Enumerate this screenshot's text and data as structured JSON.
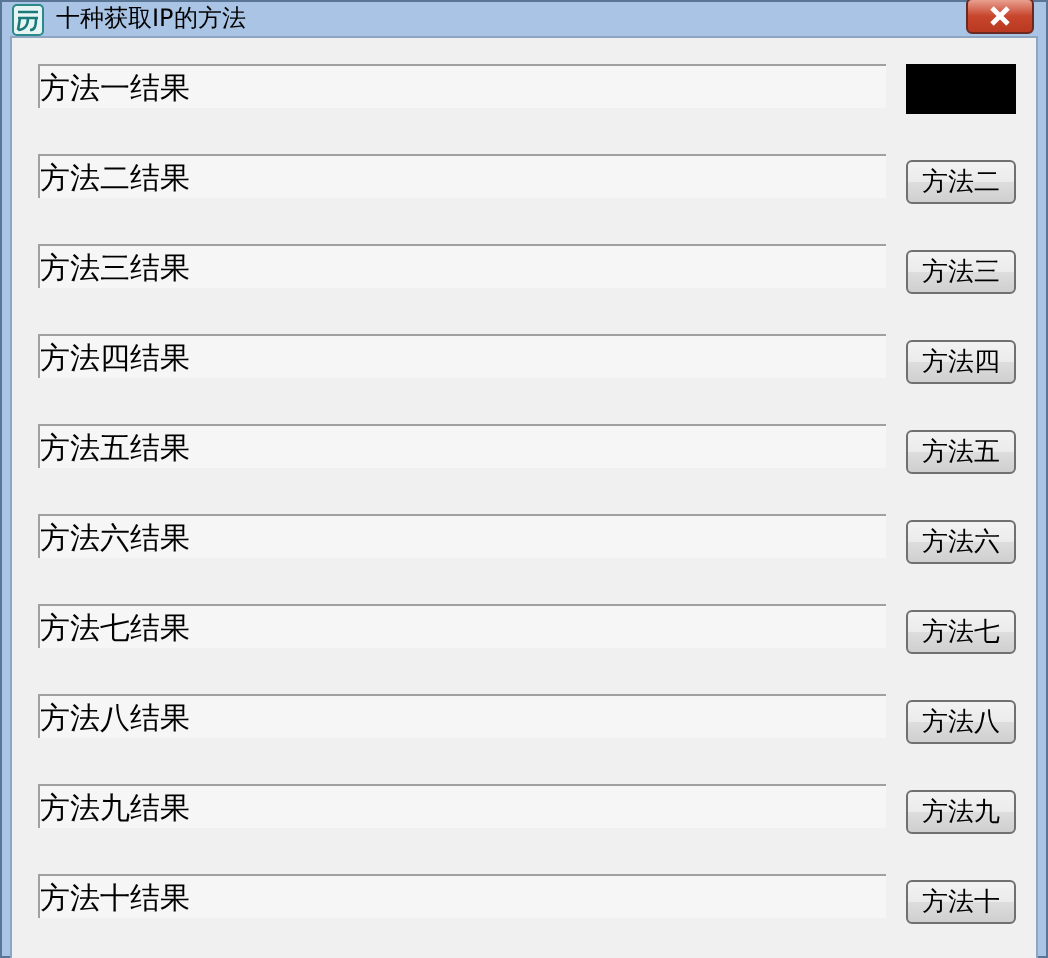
{
  "window": {
    "title": "十种获取IP的方法"
  },
  "rows": [
    {
      "result": "方法一结果",
      "button": {
        "kind": "blank"
      }
    },
    {
      "result": "方法二结果",
      "button": {
        "kind": "text",
        "label": "方法二"
      }
    },
    {
      "result": "方法三结果",
      "button": {
        "kind": "text",
        "label": "方法三"
      }
    },
    {
      "result": "方法四结果",
      "button": {
        "kind": "text",
        "label": "方法四"
      }
    },
    {
      "result": "方法五结果",
      "button": {
        "kind": "text",
        "label": "方法五"
      }
    },
    {
      "result": "方法六结果",
      "button": {
        "kind": "text",
        "label": "方法六"
      }
    },
    {
      "result": "方法七结果",
      "button": {
        "kind": "text",
        "label": "方法七"
      }
    },
    {
      "result": "方法八结果",
      "button": {
        "kind": "text",
        "label": "方法八"
      }
    },
    {
      "result": "方法九结果",
      "button": {
        "kind": "text",
        "label": "方法九"
      }
    },
    {
      "result": "方法十结果",
      "button": {
        "kind": "text",
        "label": "方法十"
      }
    }
  ]
}
